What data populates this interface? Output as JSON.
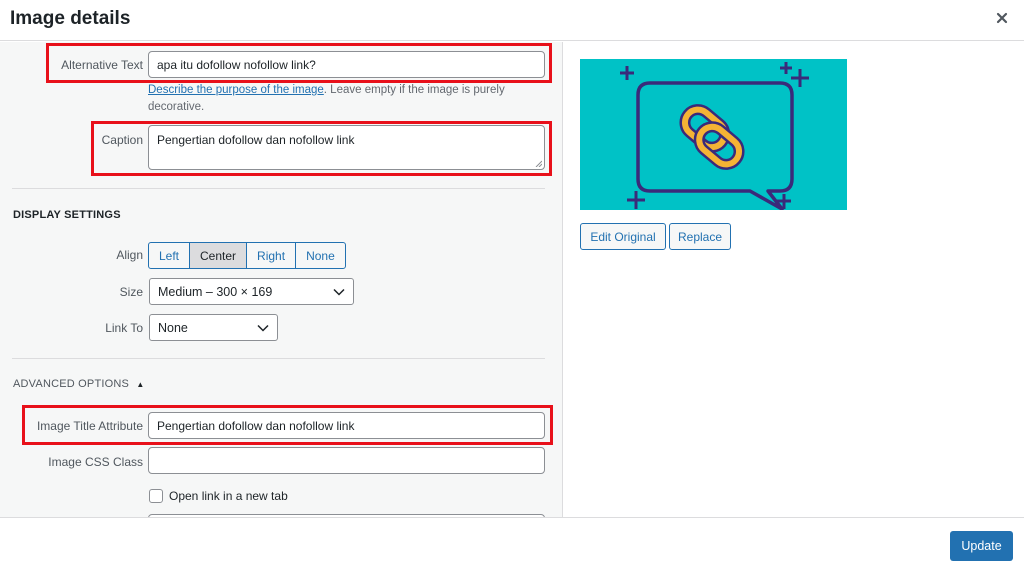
{
  "header": {
    "title": "Image details"
  },
  "alt_text": {
    "label": "Alternative Text",
    "value": "apa itu dofollow nofollow link?"
  },
  "help": {
    "link": "Describe the purpose of the image",
    "rest": ". Leave empty if the image is purely",
    "line2": "decorative."
  },
  "caption": {
    "label": "Caption",
    "value": "Pengertian dofollow dan nofollow link"
  },
  "display_settings": {
    "heading": "DISPLAY SETTINGS",
    "align_label": "Align",
    "align_options": [
      "Left",
      "Center",
      "Right",
      "None"
    ],
    "align_selected": "Center",
    "size_label": "Size",
    "size_value": "Medium – 300 × 169",
    "link_label": "Link To",
    "link_value": "None"
  },
  "advanced": {
    "heading": "ADVANCED OPTIONS",
    "arrow": "▲",
    "title_attr_label": "Image Title Attribute",
    "title_attr_value": "Pengertian dofollow dan nofollow link",
    "css_class_label": "Image CSS Class",
    "css_class_value": "",
    "new_tab_label": "Open link in a new tab"
  },
  "side": {
    "edit_original": "Edit Original",
    "replace": "Replace"
  },
  "footer": {
    "update": "Update"
  },
  "colors": {
    "accent": "#2271b1",
    "highlight": "#e8101a",
    "preview_bg": "#00c2c6",
    "chain": "#f5b335",
    "chain_outline": "#3a2a7a"
  }
}
